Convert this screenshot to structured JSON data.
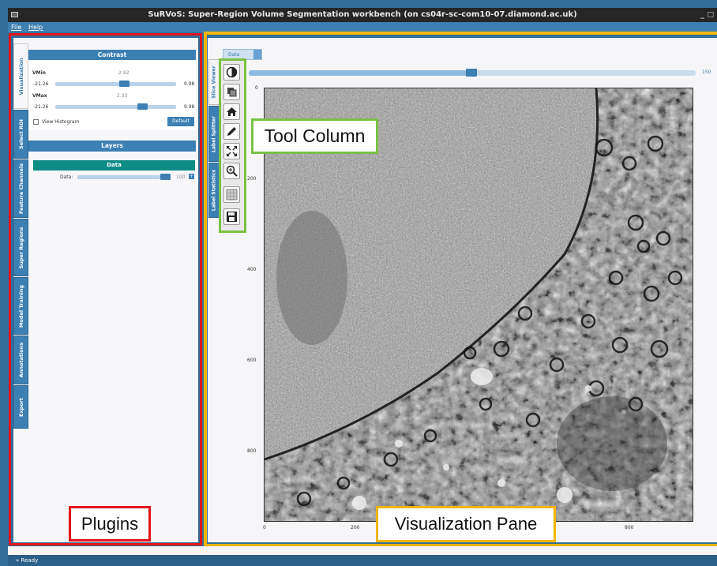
{
  "window": {
    "title": "SuRVoS: Super-Region Volume Segmentation workbench (on cs04r-sc-com10-07.diamond.ac.uk)",
    "minimize_glyph": "_",
    "maximize_glyph": "□"
  },
  "menu": {
    "file": "File",
    "help": "Help"
  },
  "left_tabs": [
    "Visualization",
    "Select ROI",
    "Feature Channels",
    "Super Regions",
    "Model Training",
    "Annotations",
    "Export"
  ],
  "contrast": {
    "header": "Contrast",
    "vmin_label": "VMin",
    "vmin_value": "-2.92",
    "vmin_low": "-21.26",
    "vmin_high": "9.98",
    "vmax_label": "VMax",
    "vmax_value": "2.33",
    "vmax_low": "-21.26",
    "vmax_high": "9.98",
    "view_histogram": "View Histogram",
    "default_button": "Default"
  },
  "layers": {
    "header": "Layers",
    "data_header": "Data",
    "data_label": "Data:",
    "data_value": "100"
  },
  "right_tabs": [
    "Slice Viewer",
    "Label Splitter",
    "Label Statistics"
  ],
  "data_tab": "Data",
  "slice_value": "150",
  "tools": [
    "contrast-icon",
    "layers-icon",
    "home-icon",
    "pencil-icon",
    "fit-to-view-icon",
    "zoom-in-icon",
    "grid-icon",
    "save-icon"
  ],
  "plot": {
    "y_ticks": [
      "0",
      "200",
      "400",
      "600",
      "800"
    ],
    "x_ticks": [
      "0",
      "200",
      "400",
      "600",
      "800"
    ]
  },
  "callouts": {
    "tool_column": "Tool Column",
    "plugins": "Plugins",
    "visualization_pane": "Visualization Pane"
  },
  "status": "Ready",
  "colors": {
    "accent": "#3b7fb3",
    "plugins_outline": "#e3141c",
    "visualization_outline": "#f3b400",
    "tool_column_outline": "#7ac143",
    "layer_header": "#0e8c86"
  }
}
